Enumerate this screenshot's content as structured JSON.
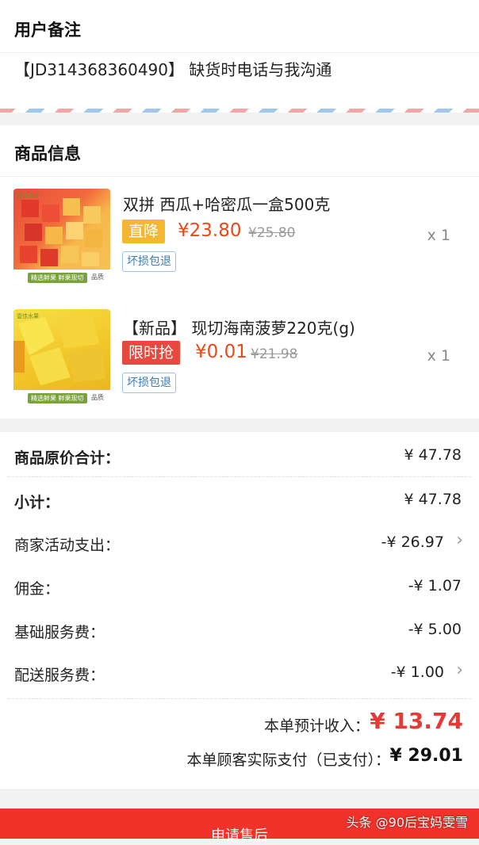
{
  "remark": {
    "title": "用户备注",
    "text": "【JD314368360490】 缺货时电话与我沟通"
  },
  "products": {
    "title": "商品信息",
    "items": [
      {
        "name": "双拼 西瓜+哈密瓜一盒500克",
        "badge": "直降",
        "badge_color": "#f5b731",
        "price": "¥23.80",
        "original_price": "¥25.80",
        "quantity": "x 1",
        "service_tag": "坏损包退",
        "thumb_band_text": "精选鲜果 鲜果现切",
        "thumb_brand": "品质",
        "thumb_tag": "壹佳水果"
      },
      {
        "name": "【新品】 现切海南菠萝220克(g)",
        "badge": "限时抢",
        "badge_color": "#e8483d",
        "price": "¥0.01",
        "original_price": "¥21.98",
        "quantity": "x 1",
        "service_tag": "坏损包退",
        "thumb_band_text": "精选鲜果 鲜果现切",
        "thumb_brand": "品质",
        "thumb_tag": "壹佳水果"
      }
    ]
  },
  "summary": {
    "original_total": {
      "label": "商品原价合计：",
      "value": "¥ 47.78"
    },
    "subtotal": {
      "label": "小计：",
      "value": "¥ 47.78"
    },
    "merchant_promo": {
      "label": "商家活动支出：",
      "value": "-¥ 26.97"
    },
    "commission": {
      "label": "佣金：",
      "value": "-¥ 1.07"
    },
    "base_service_fee": {
      "label": "基础服务费：",
      "value": "-¥ 5.00"
    },
    "delivery_fee": {
      "label": "配送服务费：",
      "value": "-¥ 1.00"
    },
    "estimated_income": {
      "label": "本单预计收入：",
      "value": "¥ 13.74"
    },
    "customer_paid": {
      "label": "本单顾客实际支付（已支付）：",
      "value": "¥ 29.01"
    }
  },
  "footer": {
    "button_label": "申请售后",
    "watermark": "头条 @90后宝妈雯雪"
  },
  "colors": {
    "accent_red": "#e53935",
    "price_orange": "#e64a19",
    "footer_red": "#f0322a"
  }
}
